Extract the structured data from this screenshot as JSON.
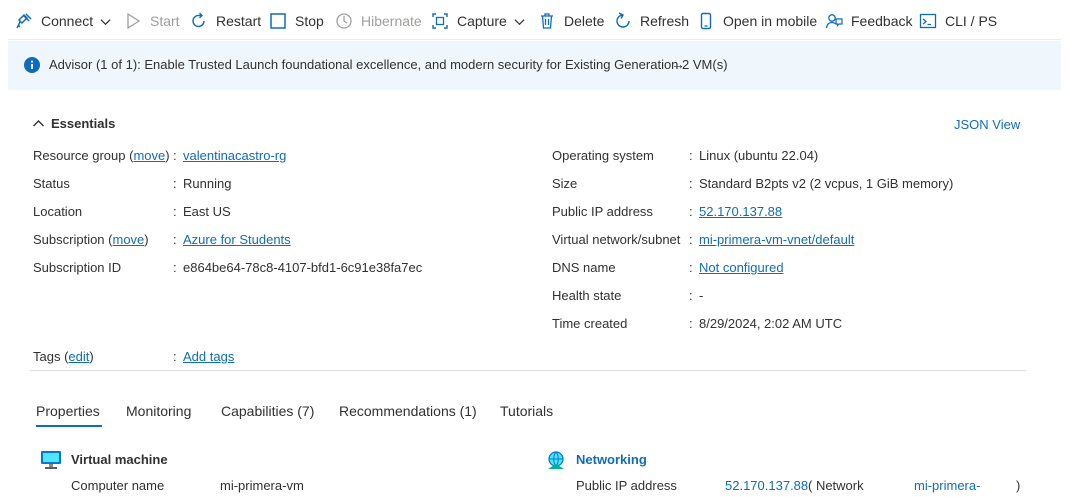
{
  "toolbar": {
    "connect": "Connect",
    "start": "Start",
    "restart": "Restart",
    "stop": "Stop",
    "hibernate": "Hibernate",
    "capture": "Capture",
    "delete": "Delete",
    "refresh": "Refresh",
    "open_mobile": "Open in mobile",
    "feedback": "Feedback",
    "cli": "CLI / PS"
  },
  "advisor": {
    "text": "Advisor (1 of 1): Enable Trusted Launch foundational excellence, and modern security for Existing Generation 2 VM(s)",
    "arrow": "→"
  },
  "essentials": {
    "title": "Essentials",
    "json_view": "JSON View",
    "left": [
      {
        "label": "Resource group",
        "move": "move",
        "value": "valentinacastro-rg",
        "link": true
      },
      {
        "label": "Status",
        "value": "Running",
        "link": false
      },
      {
        "label": "Location",
        "value": "East US",
        "link": false
      },
      {
        "label": "Subscription",
        "move": "move",
        "value": "Azure for Students",
        "link": true
      },
      {
        "label": "Subscription ID",
        "value": "e864be64-78c8-4107-bfd1-6c91e38fa7ec",
        "link": false
      }
    ],
    "right": [
      {
        "label": "Operating system",
        "value": "Linux (ubuntu 22.04)",
        "link": false
      },
      {
        "label": "Size",
        "value": "Standard B2pts v2 (2 vcpus, 1 GiB memory)",
        "link": false
      },
      {
        "label": "Public IP address",
        "value": "52.170.137.88",
        "link": true
      },
      {
        "label": "Virtual network/subnet",
        "value": "mi-primera-vm-vnet/default",
        "link": true
      },
      {
        "label": "DNS name",
        "value": "Not configured",
        "link": true
      },
      {
        "label": "Health state",
        "value": "-",
        "link": false
      },
      {
        "label": "Time created",
        "value": "8/29/2024, 2:02 AM UTC",
        "link": false
      }
    ],
    "tags": {
      "label": "Tags",
      "edit": "edit",
      "value": "Add tags"
    },
    "colon": ":"
  },
  "tabs": [
    "Properties",
    "Monitoring",
    "Capabilities (7)",
    "Recommendations (1)",
    "Tutorials"
  ],
  "vm_section": {
    "title": "Virtual machine",
    "computer_name_label": "Computer name",
    "computer_name_value": "mi-primera-vm"
  },
  "net_section": {
    "title": "Networking",
    "public_ip_label": "Public IP address",
    "public_ip_value": "52.170.137.88",
    "network_text": "( Network",
    "network_link": "mi-primera-",
    "close_paren": ")"
  },
  "colors": {
    "accent": "#0f6cbd",
    "advisor_bg": "#eff6fc"
  }
}
